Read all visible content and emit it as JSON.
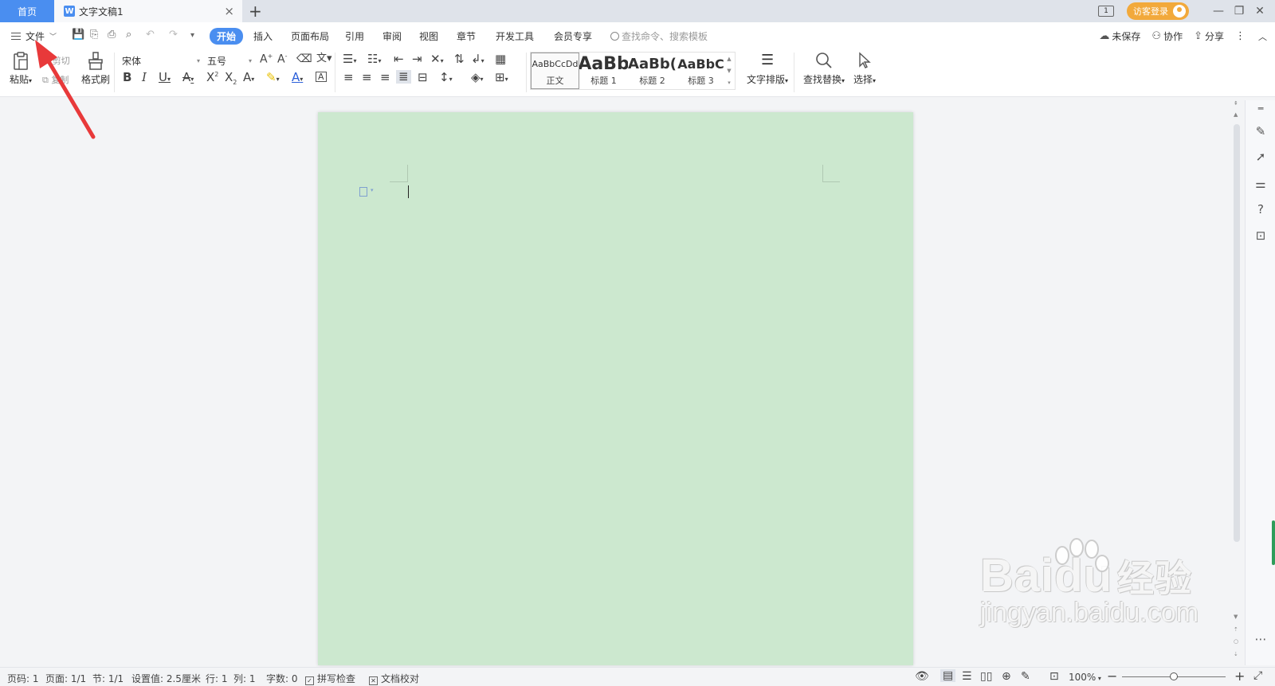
{
  "tabs": {
    "home": "首页",
    "doc_title": "文字文稿1",
    "doc_icon": "W",
    "add": "+",
    "close": "×"
  },
  "titlebar_right": {
    "window_indicator": "1",
    "login": "访客登录",
    "minimize": "—",
    "restore": "❐",
    "close": "✕"
  },
  "menu": {
    "file": "文件",
    "tabs": [
      "开始",
      "插入",
      "页面布局",
      "引用",
      "审阅",
      "视图",
      "章节",
      "开发工具",
      "会员专享"
    ],
    "active_tab": "开始",
    "search_placeholder": "查找命令、搜索模板",
    "unsaved": "未保存",
    "collab": "协作",
    "share": "分享"
  },
  "ribbon": {
    "paste": "粘贴",
    "cut": "剪切",
    "copy": "复制",
    "format_painter": "格式刷",
    "font_name": "宋体",
    "font_size": "五号",
    "styles": [
      {
        "preview": "AaBbCcDd",
        "name": "正文"
      },
      {
        "preview": "AaBb",
        "name": "标题 1"
      },
      {
        "preview": "AaBb(",
        "name": "标题 2"
      },
      {
        "preview": "AaBbC",
        "name": "标题 3"
      }
    ],
    "text_layout": "文字排版",
    "find_replace": "查找替换",
    "select": "选择"
  },
  "status": {
    "page_num": "页码: 1",
    "pages": "页面: 1/1",
    "section": "节: 1/1",
    "setting": "设置值: 2.5厘米",
    "row": "行: 1",
    "col": "列: 1",
    "word_count": "字数: 0",
    "spell_check": "拼写检查",
    "doc_proof": "文档校对",
    "zoom": "100%",
    "zoom_fraction": 0.5
  },
  "watermark": {
    "brand": "Bai",
    "brand2": "du",
    "brand_cn": "经验",
    "url": "jingyan.baidu.com"
  },
  "colors": {
    "accent": "#4a8ef0",
    "page_background": "#cce8cf",
    "login_orange": "#f2a93b",
    "annotation_arrow": "#e8393a"
  }
}
